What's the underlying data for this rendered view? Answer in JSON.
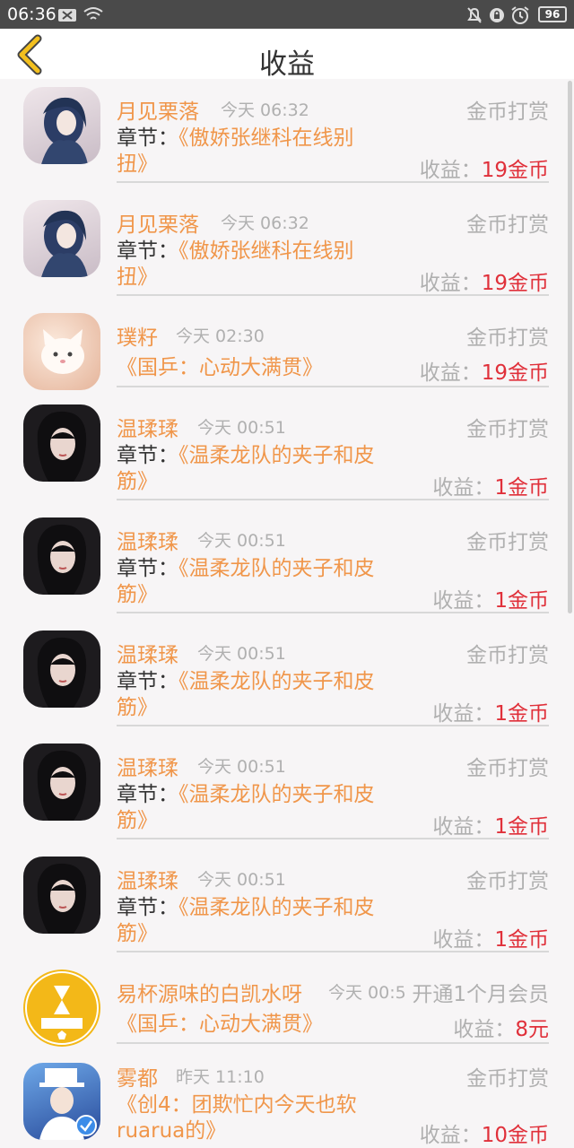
{
  "status": {
    "time": "06:36",
    "battery": "96"
  },
  "header": {
    "title": "收益"
  },
  "labels": {
    "chapter_prefix": "章节：",
    "earn_prefix": "收益："
  },
  "items": [
    {
      "name": "月见栗落",
      "time": "今天 06:32",
      "type": "金币打赏",
      "chapter_label": "章节：",
      "chapter_line1": "《傲娇张继科在线别",
      "chapter_line2": "扭》",
      "amount": "19金币",
      "avatar": "girl-blue-hair"
    },
    {
      "name": "月见栗落",
      "time": "今天 06:32",
      "type": "金币打赏",
      "chapter_label": "章节：",
      "chapter_line1": "《傲娇张继科在线别",
      "chapter_line2": "扭》",
      "amount": "19金币",
      "avatar": "girl-blue-hair"
    },
    {
      "name": "璞籽",
      "time": "今天 02:30",
      "type": "金币打赏",
      "book": "《国乒：心动大满贯》",
      "amount": "19金币",
      "avatar": "white-kitten"
    },
    {
      "name": "温瑈瑈",
      "time": "今天 00:51",
      "type": "金币打赏",
      "chapter_label": "章节：",
      "chapter_line1": "《温柔龙队的夹子和皮",
      "chapter_line2": "筋》",
      "amount": "1金币",
      "avatar": "dark-girl"
    },
    {
      "name": "温瑈瑈",
      "time": "今天 00:51",
      "type": "金币打赏",
      "chapter_label": "章节：",
      "chapter_line1": "《温柔龙队的夹子和皮",
      "chapter_line2": "筋》",
      "amount": "1金币",
      "avatar": "dark-girl"
    },
    {
      "name": "温瑈瑈",
      "time": "今天 00:51",
      "type": "金币打赏",
      "chapter_label": "章节：",
      "chapter_line1": "《温柔龙队的夹子和皮",
      "chapter_line2": "筋》",
      "amount": "1金币",
      "avatar": "dark-girl"
    },
    {
      "name": "温瑈瑈",
      "time": "今天 00:51",
      "type": "金币打赏",
      "chapter_label": "章节：",
      "chapter_line1": "《温柔龙队的夹子和皮",
      "chapter_line2": "筋》",
      "amount": "1金币",
      "avatar": "dark-girl"
    },
    {
      "name": "温瑈瑈",
      "time": "今天 00:51",
      "type": "金币打赏",
      "chapter_label": "章节：",
      "chapter_line1": "《温柔龙队的夹子和皮",
      "chapter_line2": "筋》",
      "amount": "1金币",
      "avatar": "dark-girl"
    },
    {
      "name": "易杯源味的白凯水呀",
      "time": "今天 00:5",
      "type": "开通1个月会员",
      "book": "《国乒：心动大满贯》",
      "amount": "8元",
      "avatar": "tfboys-logo"
    },
    {
      "name": "雾都",
      "time": "昨天 11:10",
      "type": "金币打赏",
      "book_line1": "《创4：团欺忙内今天也软",
      "book_line2": "ruarua的》",
      "amount": "10金币",
      "avatar": "kid-in-white"
    }
  ]
}
